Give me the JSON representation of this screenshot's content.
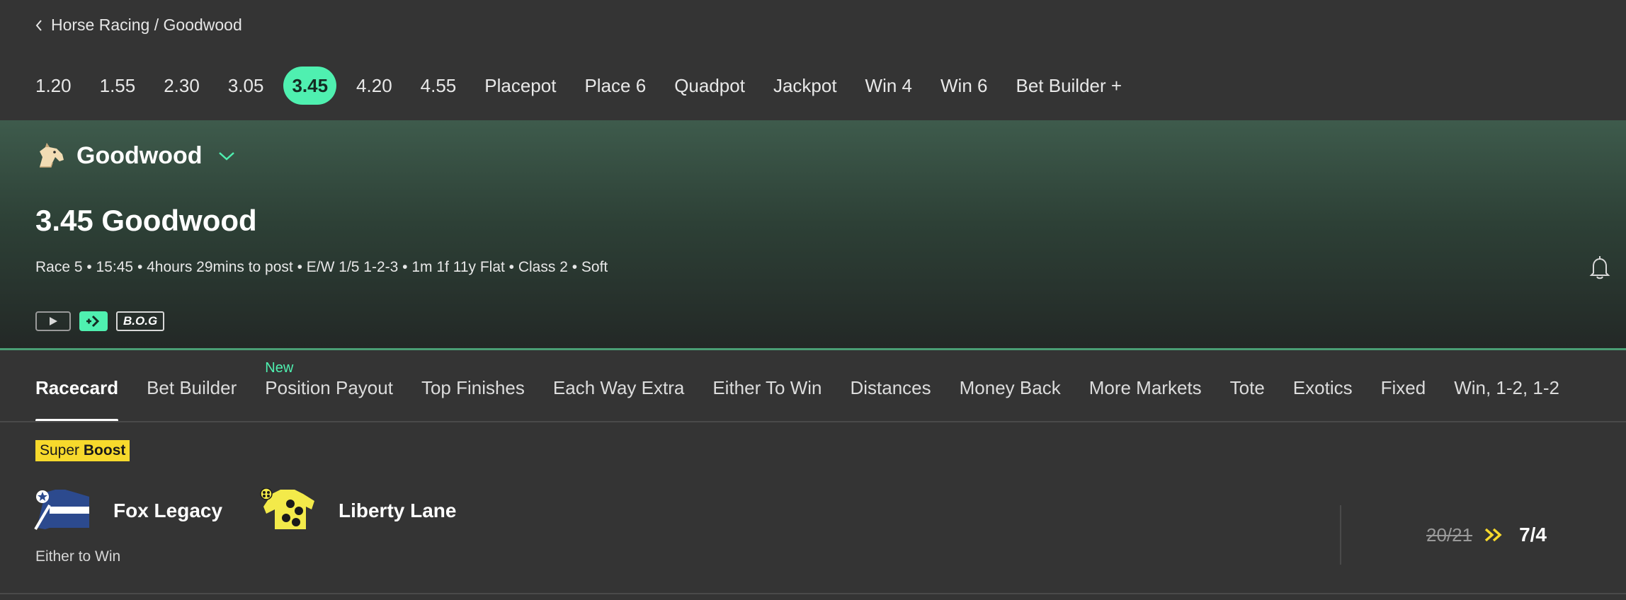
{
  "breadcrumb": {
    "text": "Horse Racing / Goodwood"
  },
  "race_nav": {
    "items": [
      "1.20",
      "1.55",
      "2.30",
      "3.05",
      "3.45",
      "4.20",
      "4.55",
      "Placepot",
      "Place 6",
      "Quadpot",
      "Jackpot",
      "Win 4",
      "Win 6",
      "Bet Builder +"
    ],
    "active": "3.45"
  },
  "course": {
    "name": "Goodwood",
    "icon": "horse-head-icon"
  },
  "race": {
    "title": "3.45 Goodwood",
    "info": "Race 5 • 15:45 • 4hours 29mins to post • E/W 1/5 1-2-3 • 1m 1f 11y Flat • Class 2 • Soft",
    "badge_bog": "B.O.G"
  },
  "tabs": {
    "items": [
      "Racecard",
      "Bet Builder",
      "Position Payout",
      "Top Finishes",
      "Each Way Extra",
      "Either To Win",
      "Distances",
      "Money Back",
      "More Markets",
      "Tote",
      "Exotics",
      "Fixed",
      "Win, 1-2, 1-2"
    ],
    "active": "Racecard",
    "new_label": "New",
    "new_on": "Position Payout"
  },
  "boost": {
    "label_super": "Super",
    "label_boost": "Boost",
    "runners": [
      "Fox Legacy",
      "Liberty Lane"
    ],
    "market": "Either to Win",
    "old_price": "20/21",
    "new_price": "7/4"
  },
  "colors": {
    "accent": "#4ff0b0",
    "background": "#343434",
    "boost_yellow": "#f7d92c"
  }
}
